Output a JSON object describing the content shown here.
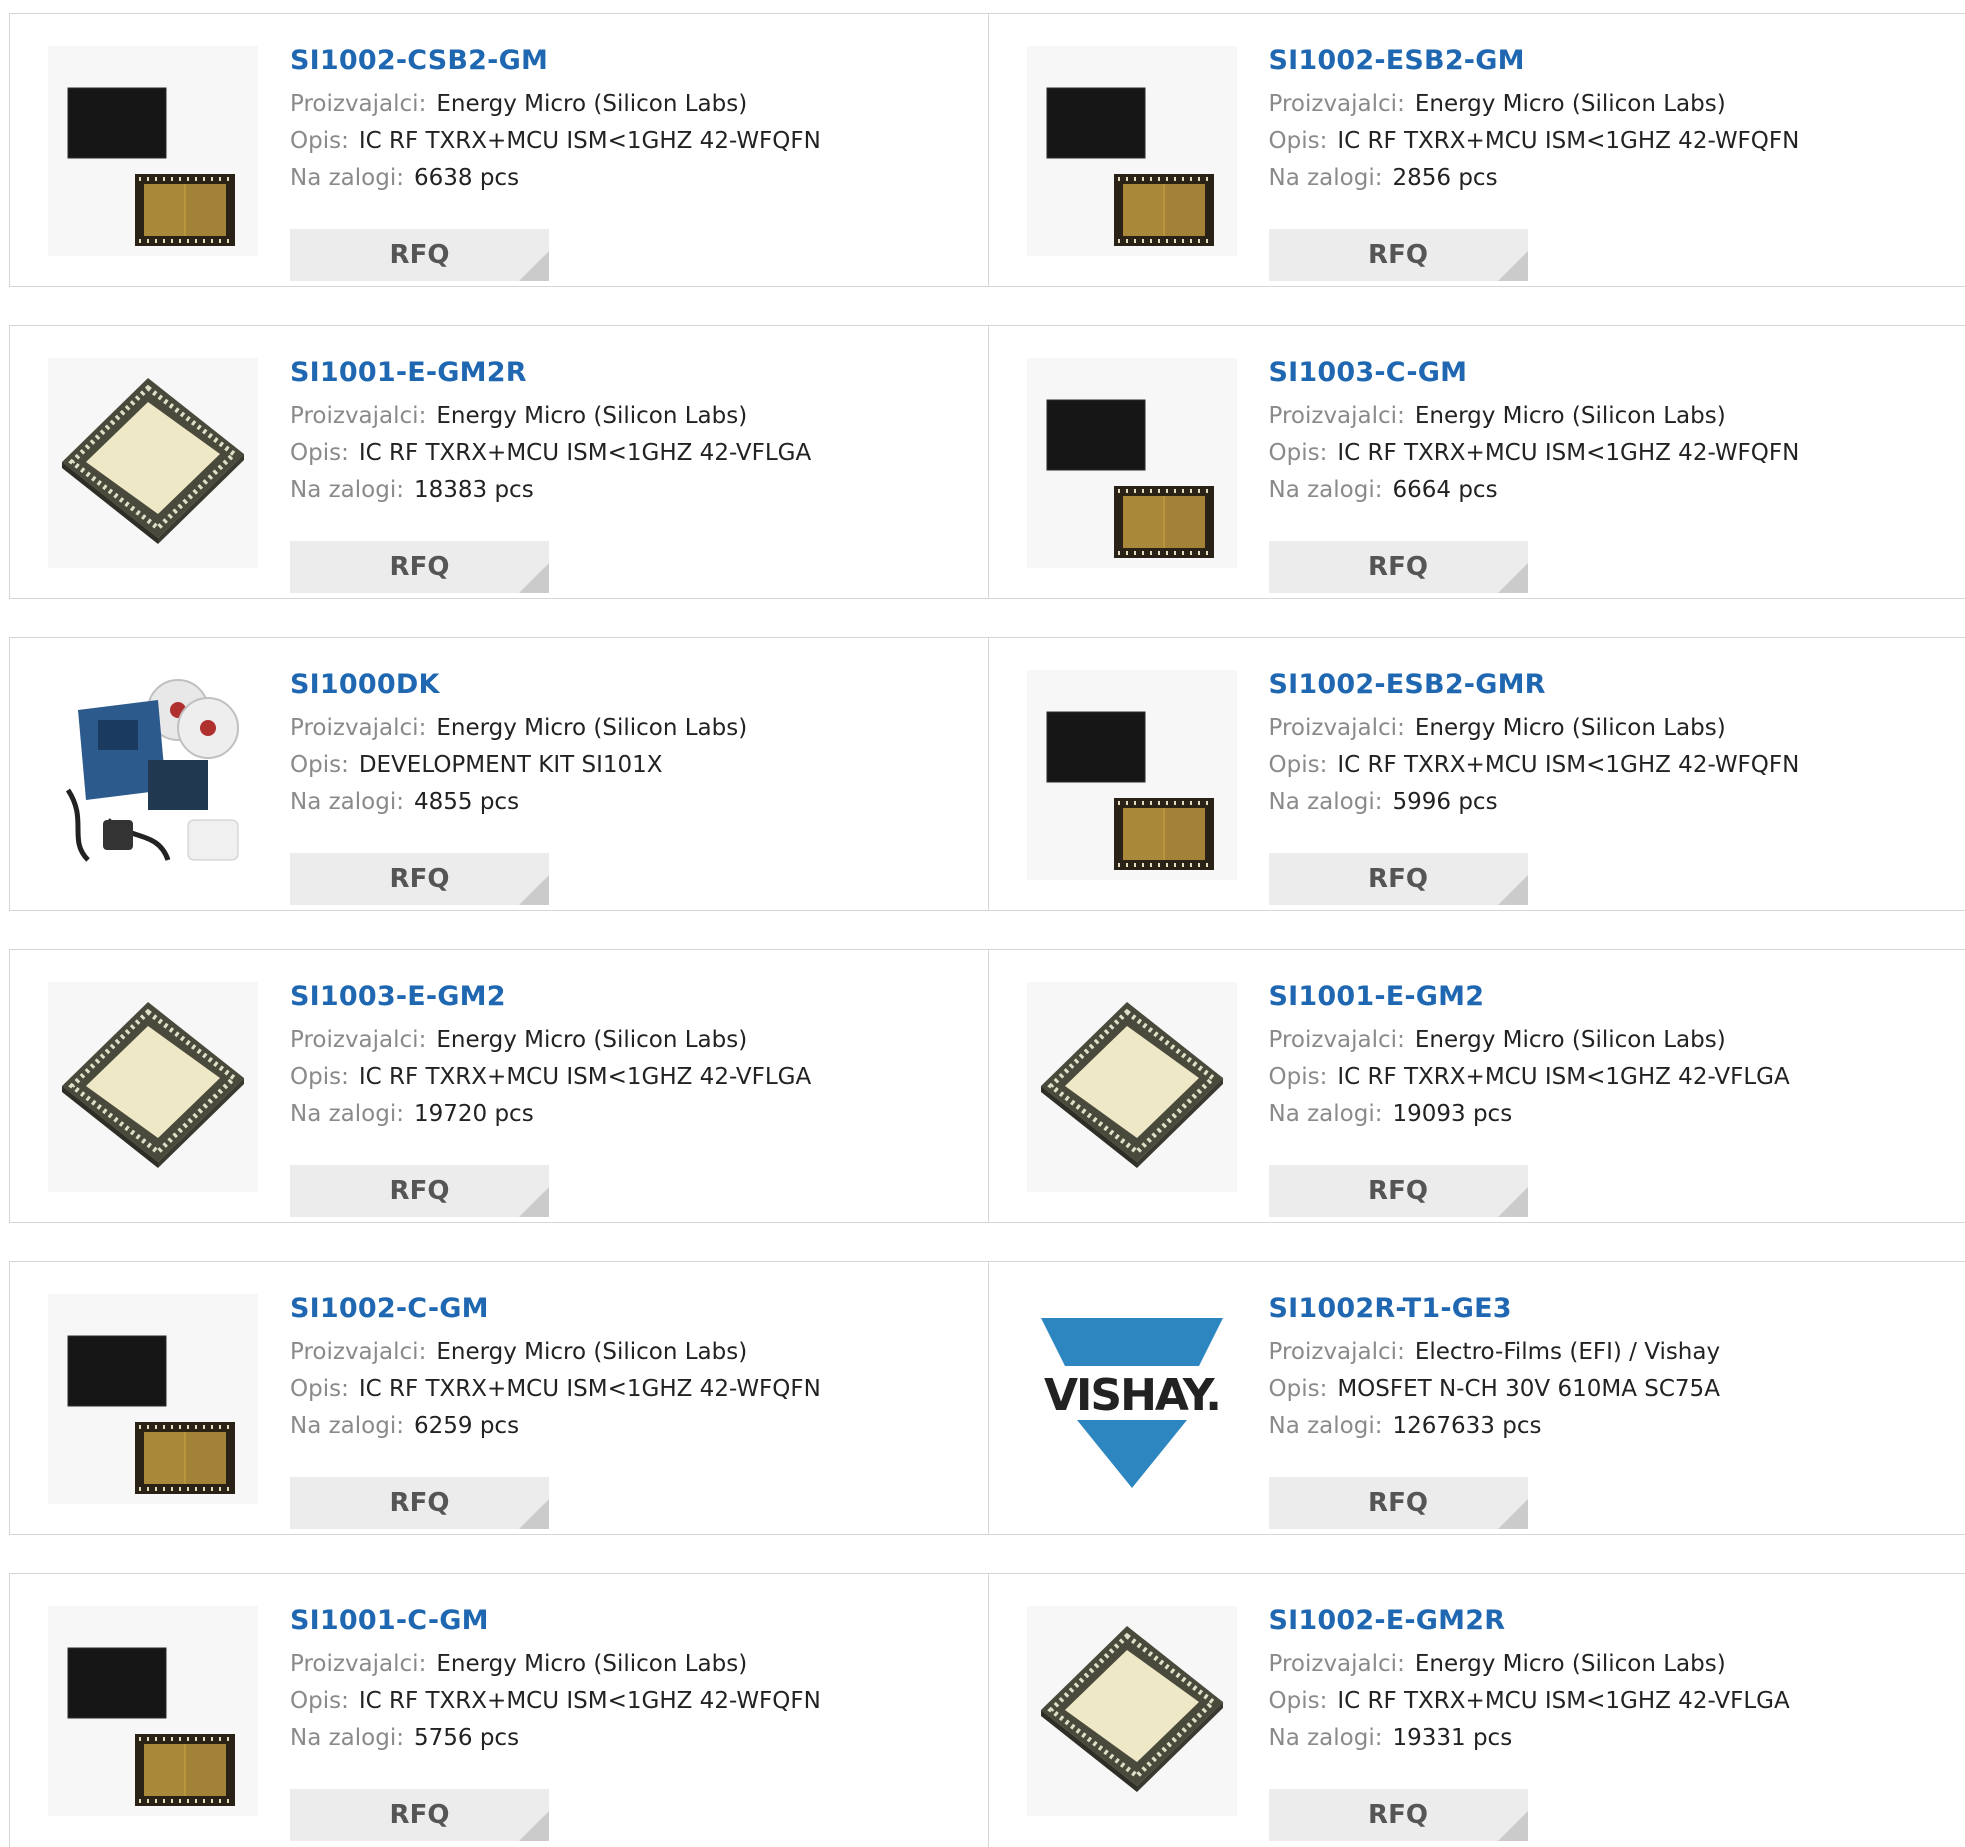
{
  "labels": {
    "manufacturer": "Proizvajalci:",
    "description": "Opis:",
    "stock": "Na zalogi:",
    "rfq": "RFQ"
  },
  "colors": {
    "link": "#1f68b1",
    "label": "#8a8a8a",
    "button": "#ececec",
    "vishay_blue": "#2e86c1"
  },
  "products": [
    {
      "name": "SI1002-CSB2-GM",
      "manufacturer": "Energy Micro (Silicon Labs)",
      "description": "IC RF TXRX+MCU ISM<1GHZ 42-WFQFN",
      "stock": "6638 pcs",
      "image": "wfqfn-chip-icon"
    },
    {
      "name": "SI1002-ESB2-GM",
      "manufacturer": "Energy Micro (Silicon Labs)",
      "description": "IC RF TXRX+MCU ISM<1GHZ 42-WFQFN",
      "stock": "2856 pcs",
      "image": "wfqfn-chip-icon"
    },
    {
      "name": "SI1001-E-GM2R",
      "manufacturer": "Energy Micro (Silicon Labs)",
      "description": "IC RF TXRX+MCU ISM<1GHZ 42-VFLGA",
      "stock": "18383 pcs",
      "image": "vflga-chip-icon"
    },
    {
      "name": "SI1003-C-GM",
      "manufacturer": "Energy Micro (Silicon Labs)",
      "description": "IC RF TXRX+MCU ISM<1GHZ 42-WFQFN",
      "stock": "6664 pcs",
      "image": "wfqfn-chip-icon"
    },
    {
      "name": "SI1000DK",
      "manufacturer": "Energy Micro (Silicon Labs)",
      "description": "DEVELOPMENT KIT SI101X",
      "stock": "4855 pcs",
      "image": "dev-kit-icon"
    },
    {
      "name": "SI1002-ESB2-GMR",
      "manufacturer": "Energy Micro (Silicon Labs)",
      "description": "IC RF TXRX+MCU ISM<1GHZ 42-WFQFN",
      "stock": "5996 pcs",
      "image": "wfqfn-chip-icon"
    },
    {
      "name": "SI1003-E-GM2",
      "manufacturer": "Energy Micro (Silicon Labs)",
      "description": "IC RF TXRX+MCU ISM<1GHZ 42-VFLGA",
      "stock": "19720 pcs",
      "image": "vflga-chip-icon"
    },
    {
      "name": "SI1001-E-GM2",
      "manufacturer": "Energy Micro (Silicon Labs)",
      "description": "IC RF TXRX+MCU ISM<1GHZ 42-VFLGA",
      "stock": "19093 pcs",
      "image": "vflga-chip-icon"
    },
    {
      "name": "SI1002-C-GM",
      "manufacturer": "Energy Micro (Silicon Labs)",
      "description": "IC RF TXRX+MCU ISM<1GHZ 42-WFQFN",
      "stock": "6259 pcs",
      "image": "wfqfn-chip-icon"
    },
    {
      "name": "SI1002R-T1-GE3",
      "manufacturer": "Electro-Films (EFI) / Vishay",
      "description": "MOSFET N-CH 30V 610MA SC75A",
      "stock": "1267633 pcs",
      "image": "vishay-logo",
      "logo_text": "VISHAY."
    },
    {
      "name": "SI1001-C-GM",
      "manufacturer": "Energy Micro (Silicon Labs)",
      "description": "IC RF TXRX+MCU ISM<1GHZ 42-WFQFN",
      "stock": "5756 pcs",
      "image": "wfqfn-chip-icon"
    },
    {
      "name": "SI1002-E-GM2R",
      "manufacturer": "Energy Micro (Silicon Labs)",
      "description": "IC RF TXRX+MCU ISM<1GHZ 42-VFLGA",
      "stock": "19331 pcs",
      "image": "vflga-chip-icon"
    }
  ]
}
